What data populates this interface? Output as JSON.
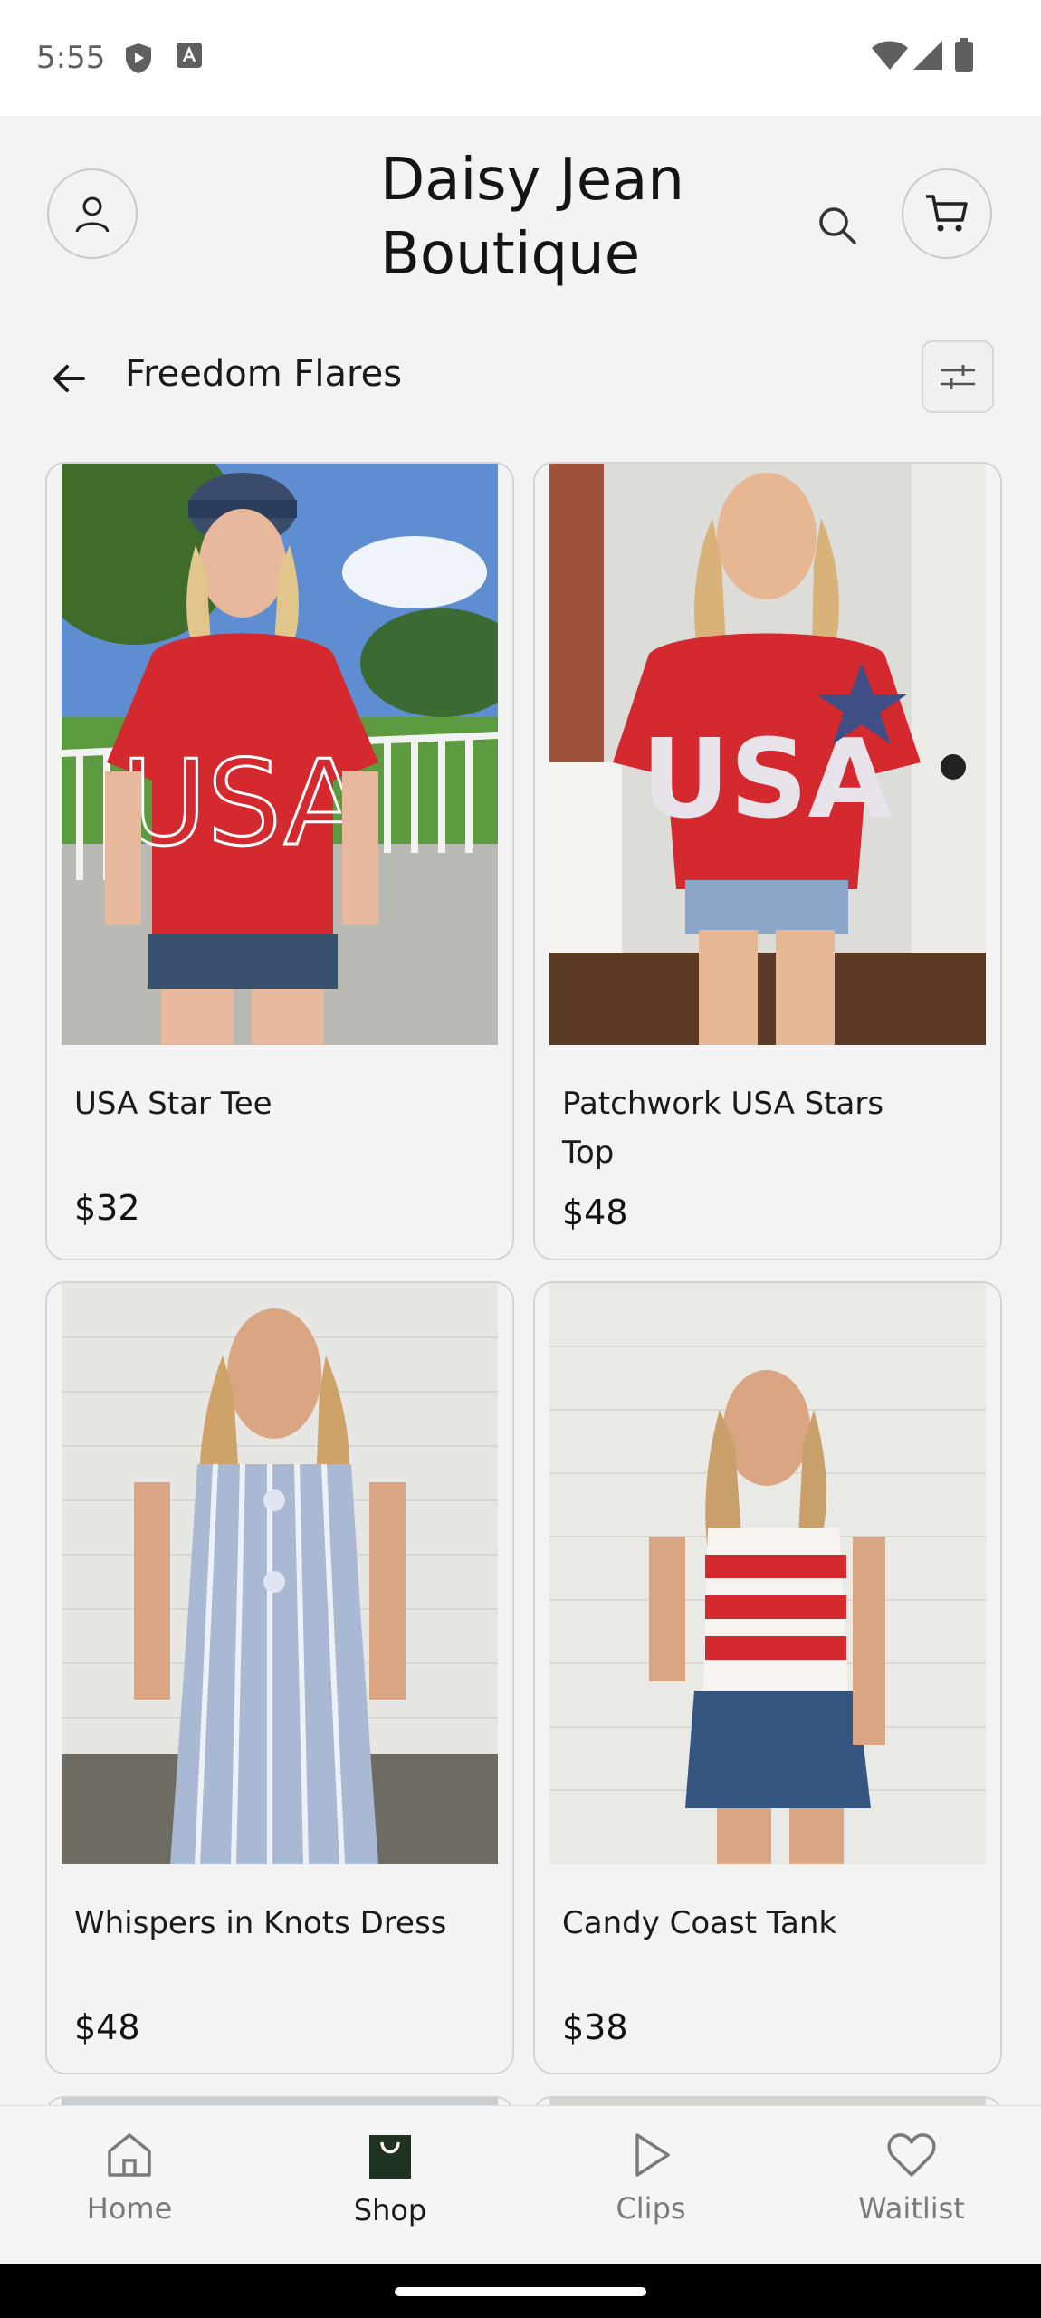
{
  "status_bar": {
    "time": "5:55"
  },
  "header": {
    "brand_title": "Daisy Jean Boutique"
  },
  "collection": {
    "title": "Freedom Flares"
  },
  "products": [
    {
      "name": "USA Star Tee",
      "price": "$32"
    },
    {
      "name": "Patchwork USA Stars Top",
      "price": "$48"
    },
    {
      "name": "Whispers in Knots Dress",
      "price": "$48"
    },
    {
      "name": "Candy Coast Tank",
      "price": "$38"
    }
  ],
  "bottom_nav": {
    "items": [
      {
        "label": "Home",
        "icon": "home-icon",
        "active": false
      },
      {
        "label": "Shop",
        "icon": "shop-bag-icon",
        "active": true
      },
      {
        "label": "Clips",
        "icon": "play-icon",
        "active": false
      },
      {
        "label": "Waitlist",
        "icon": "heart-icon",
        "active": false
      }
    ]
  },
  "colors": {
    "accent_dark": "#1e3322",
    "shirt_red": "#d42a2f",
    "nav_inactive": "#7a7a7a"
  }
}
